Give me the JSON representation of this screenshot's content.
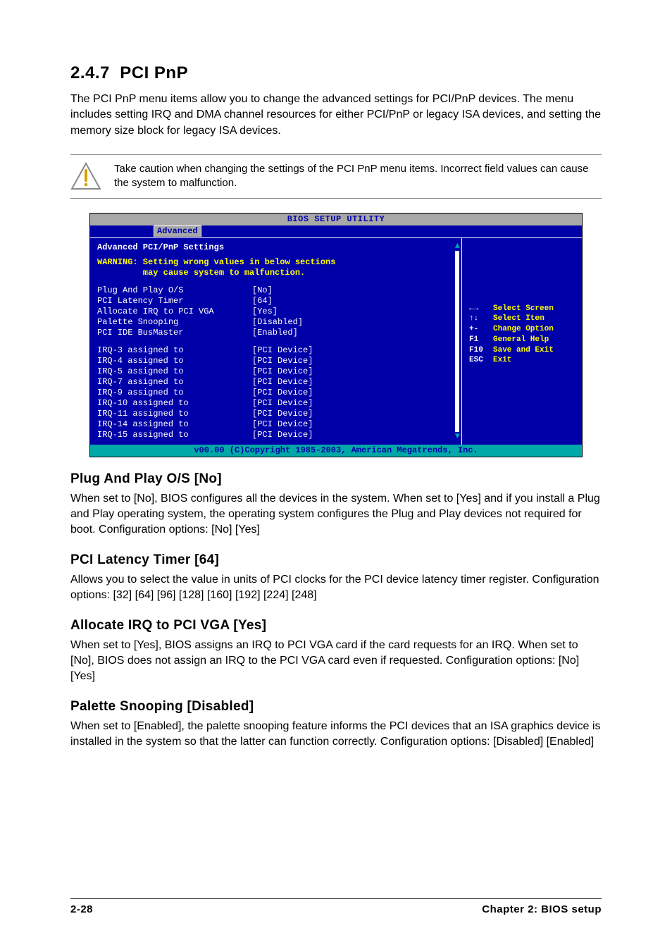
{
  "section": {
    "number": "2.4.7",
    "title": "PCI PnP",
    "intro": "The PCI PnP menu items allow you to change the advanced settings for PCI/PnP devices. The menu includes setting IRQ and DMA channel resources for either PCI/PnP or legacy ISA devices, and setting the memory size block for legacy ISA devices."
  },
  "caution": "Take caution when changing the settings of the PCI PnP menu items. Incorrect field values can cause the system to malfunction.",
  "bios": {
    "title": "BIOS SETUP UTILITY",
    "tab": "Advanced",
    "panel_heading": "Advanced PCI/PnP Settings",
    "warning_line1": "WARNING: Setting wrong values in below sections",
    "warning_line2": "         may cause system to malfunction.",
    "settings_top": [
      {
        "label": "Plug And Play O/S",
        "value": "[No]"
      },
      {
        "label": "PCI Latency Timer",
        "value": "[64]"
      },
      {
        "label": "Allocate IRQ to PCI VGA",
        "value": "[Yes]"
      },
      {
        "label": "Palette Snooping",
        "value": "[Disabled]"
      },
      {
        "label": "PCI IDE BusMaster",
        "value": "[Enabled]"
      }
    ],
    "settings_irq": [
      {
        "label": "IRQ-3 assigned to",
        "value": "[PCI Device]"
      },
      {
        "label": "IRQ-4 assigned to",
        "value": "[PCI Device]"
      },
      {
        "label": "IRQ-5 assigned to",
        "value": "[PCI Device]"
      },
      {
        "label": "IRQ-7 assigned to",
        "value": "[PCI Device]"
      },
      {
        "label": "IRQ-9 assigned to",
        "value": "[PCI Device]"
      },
      {
        "label": "IRQ-10 assigned to",
        "value": "[PCI Device]"
      },
      {
        "label": "IRQ-11 assigned to",
        "value": "[PCI Device]"
      },
      {
        "label": "IRQ-14 assigned to",
        "value": "[PCI Device]"
      },
      {
        "label": "IRQ-15 assigned to",
        "value": "[PCI Device]"
      }
    ],
    "help": [
      {
        "key": "←→",
        "desc": "Select Screen"
      },
      {
        "key": "↑↓",
        "desc": "Select Item"
      },
      {
        "key": "+-",
        "desc": "Change Option"
      },
      {
        "key": "F1",
        "desc": "General Help"
      },
      {
        "key": "F10",
        "desc": "Save and Exit"
      },
      {
        "key": "ESC",
        "desc": "Exit"
      }
    ],
    "footer": "v00.00 (C)Copyright 1985-2003, American Megatrends, Inc."
  },
  "settings": {
    "plug_and_play": {
      "heading": "Plug And Play O/S [No]",
      "body": "When set to [No], BIOS configures all the devices in the system. When set to [Yes] and if you install a Plug and Play operating system, the operating system configures the Plug and Play devices not required for boot. Configuration options: [No] [Yes]"
    },
    "pci_latency": {
      "heading": "PCI Latency Timer [64]",
      "body": "Allows you to select the value in units of PCI clocks for the PCI device latency timer register. Configuration options: [32] [64] [96] [128] [160] [192] [224] [248]"
    },
    "allocate_irq": {
      "heading": "Allocate IRQ to PCI VGA [Yes]",
      "body": "When set to [Yes], BIOS assigns an IRQ to PCI VGA card if the card requests for an IRQ. When set to [No], BIOS does not assign an IRQ to the PCI VGA card even if requested. Configuration options: [No] [Yes]"
    },
    "palette_snooping": {
      "heading": "Palette Snooping [Disabled]",
      "body": "When set to [Enabled], the palette snooping feature informs the PCI devices that an ISA graphics device is installed in the system so that the latter can function correctly. Configuration options: [Disabled] [Enabled]"
    }
  },
  "footer": {
    "left": "2-28",
    "right": "Chapter 2: BIOS setup"
  }
}
